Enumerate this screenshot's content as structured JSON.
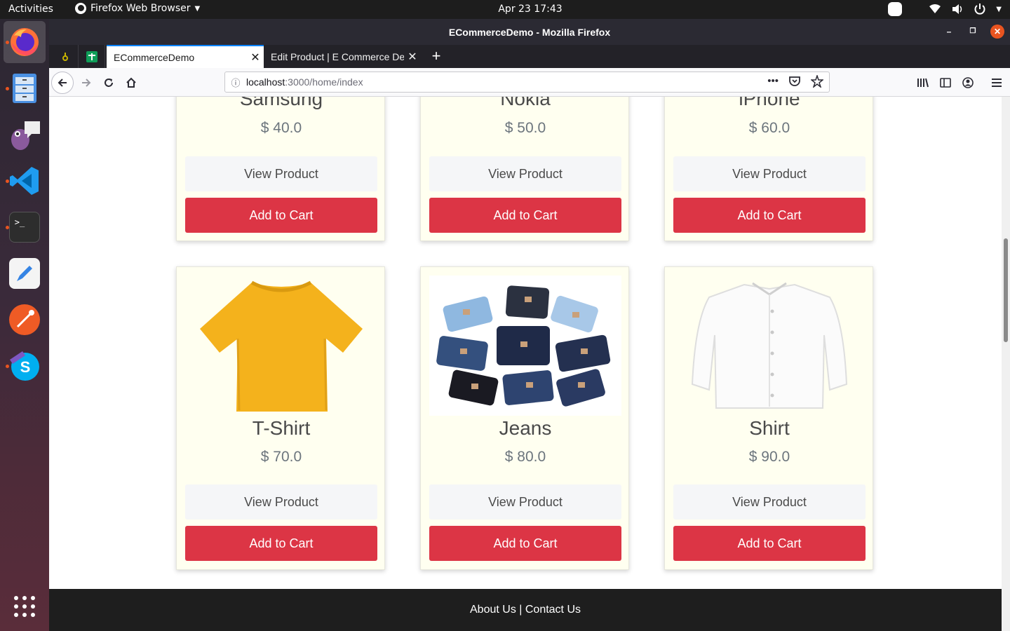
{
  "topbar": {
    "activities": "Activities",
    "app_menu": "Firefox Web Browser",
    "clock": "Apr 23  17:43"
  },
  "window": {
    "title": "ECommerceDemo - Mozilla Firefox"
  },
  "tabs": [
    {
      "label": "ECommerceDemo",
      "active": true
    },
    {
      "label": "Edit Product | E Commerce Demo",
      "active": false
    }
  ],
  "url": {
    "host": "localhost",
    "path": ":3000/home/index"
  },
  "products_top": [
    {
      "name": "Samsung",
      "price": "$ 40.0"
    },
    {
      "name": "Nokia",
      "price": "$ 50.0"
    },
    {
      "name": "iPhone",
      "price": "$ 60.0"
    }
  ],
  "products_bottom": [
    {
      "name": "T-Shirt",
      "price": "$ 70.0"
    },
    {
      "name": "Jeans",
      "price": "$ 80.0"
    },
    {
      "name": "Shirt",
      "price": "$ 90.0"
    }
  ],
  "buttons": {
    "view": "View Product",
    "cart": "Add to Cart"
  },
  "footer": {
    "about": "About Us",
    "separator": " | ",
    "contact": "Contact Us"
  },
  "colors": {
    "cart_button": "#dc3545",
    "card_bg": "#fffff0",
    "footer_bg": "#1e1e1e",
    "dock_accent": "#e95420"
  }
}
